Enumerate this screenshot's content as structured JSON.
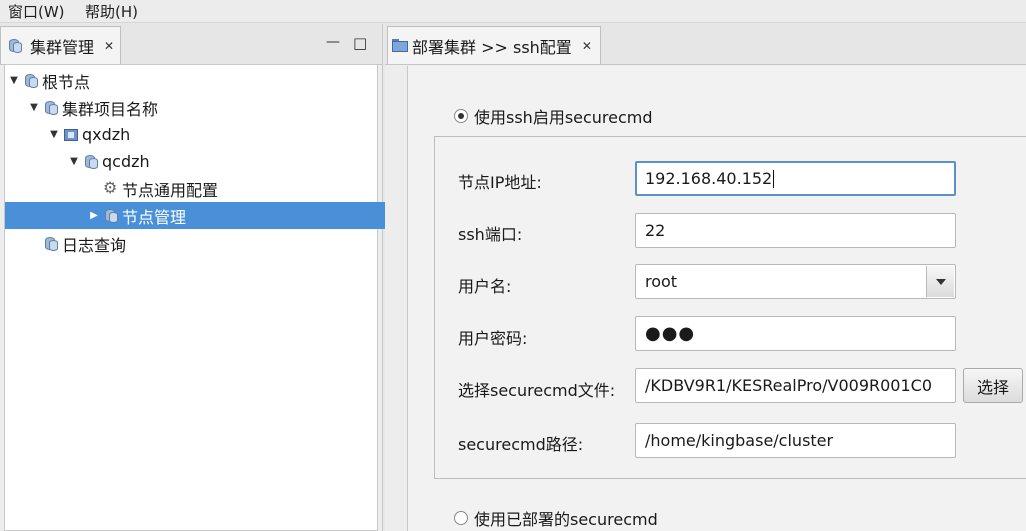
{
  "menubar": {
    "items": [
      "窗口(W)",
      "帮助(H)"
    ]
  },
  "left_panel": {
    "tab_title": "集群管理",
    "tree": [
      {
        "label": "根节点",
        "expanded": true,
        "icon": "database-icon"
      },
      {
        "label": "集群项目名称",
        "expanded": true,
        "icon": "database-icon"
      },
      {
        "label": "qxdzh",
        "expanded": true,
        "icon": "cluster-icon"
      },
      {
        "label": "qcdzh",
        "expanded": true,
        "icon": "database-icon"
      },
      {
        "label": "节点通用配置",
        "icon": "gear-icon"
      },
      {
        "label": "节点管理",
        "expanded": false,
        "selected": true,
        "icon": "database-icon"
      },
      {
        "label": "日志查询",
        "icon": "database-icon"
      }
    ]
  },
  "right_panel": {
    "tab_title": "部署集群 >> ssh配置",
    "option_ssh": {
      "label": "使用ssh启用securecmd",
      "checked": true
    },
    "option_deployed": {
      "label": "使用已部署的securecmd",
      "checked": false
    },
    "fields": {
      "ip": {
        "label": "节点IP地址:",
        "value": "192.168.40.152"
      },
      "port": {
        "label": "ssh端口:",
        "value": "22"
      },
      "user": {
        "label": "用户名:",
        "value": "root"
      },
      "password": {
        "label": "用户密码:",
        "value": "●●●"
      },
      "file": {
        "label": "选择securecmd文件:",
        "value": "/KDBV9R1/KESRealPro/V009R001C0",
        "button": "选择"
      },
      "path": {
        "label": "securecmd路径:",
        "value": "/home/kingbase/cluster"
      }
    }
  },
  "colors": {
    "selection": "#4a90d9",
    "focus_border": "#5b8fd0"
  }
}
